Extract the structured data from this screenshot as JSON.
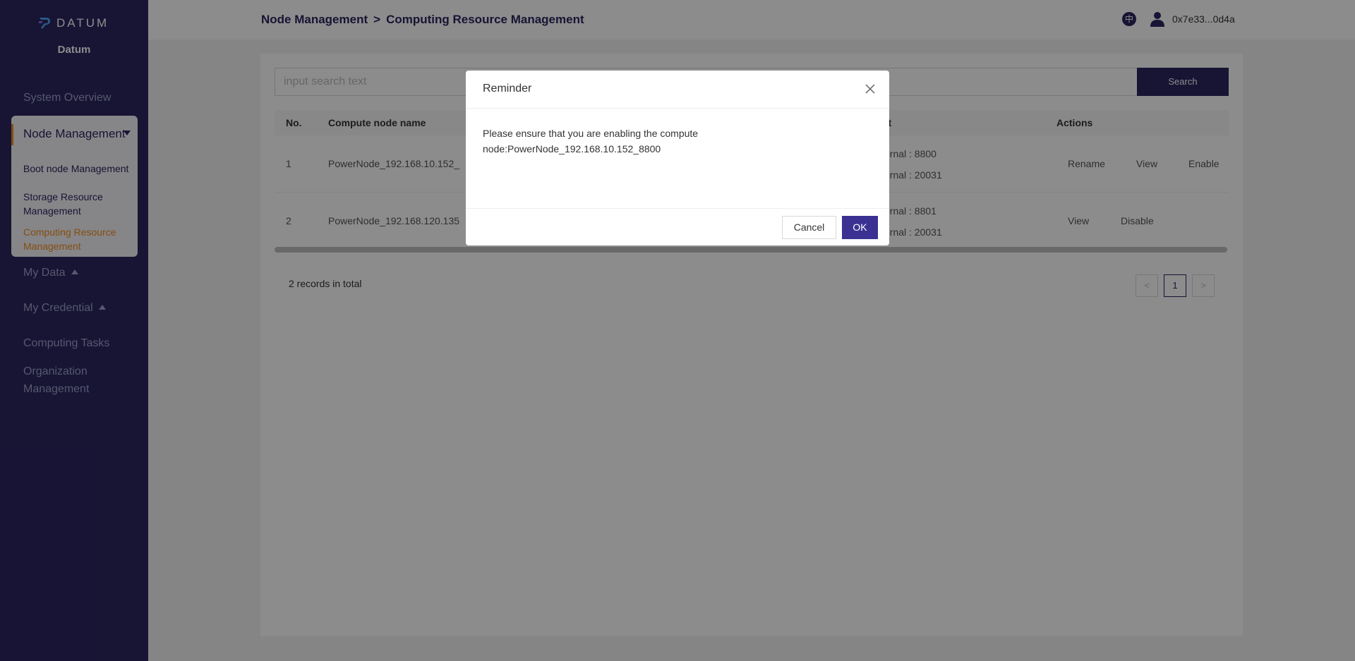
{
  "sidebar": {
    "logo_text": "DATUM",
    "org_name": "Datum",
    "system_overview": "System Overview",
    "node_management": "Node Management",
    "boot_node": "Boot node Management",
    "storage_resource": "Storage Resource Management",
    "computing_resource": "Computing Resource Management",
    "my_data": "My Data",
    "my_credential": "My Credential",
    "computing_tasks": "Computing Tasks",
    "organization_management": "Organization Management",
    "accent_color": "#f08c1e",
    "bg_color": "#2b2560"
  },
  "header": {
    "breadcrumb_parent": "Node Management",
    "breadcrumb_sep": ">",
    "breadcrumb_current": "Computing Resource Management",
    "lang_icon": "中",
    "user_address": "0x7e33...0d4a"
  },
  "main": {
    "search": {
      "placeholder": "input search text",
      "button": "Search"
    },
    "columns": {
      "no": "No.",
      "name": "Compute node name",
      "port": "rt",
      "actions": "Actions"
    },
    "rows": [
      {
        "no": "1",
        "name": "PowerNode_192.168.10.152_",
        "port_internal": "ernal : 8800",
        "port_external": "ernal : 20031",
        "actions": [
          "Rename",
          "View",
          "Enable"
        ]
      },
      {
        "no": "2",
        "name": "PowerNode_192.168.120.135",
        "port_internal": "ernal : 8801",
        "port_external": "ernal : 20031",
        "actions": [
          "View",
          "Disable"
        ]
      }
    ],
    "total": "2 records in total",
    "pagination": {
      "prev": "<",
      "page": "1",
      "next": ">"
    }
  },
  "modal": {
    "title": "Reminder",
    "message": "Please ensure that you are enabling the compute node:PowerNode_192.168.10.152_8800",
    "cancel": "Cancel",
    "ok": "OK"
  }
}
